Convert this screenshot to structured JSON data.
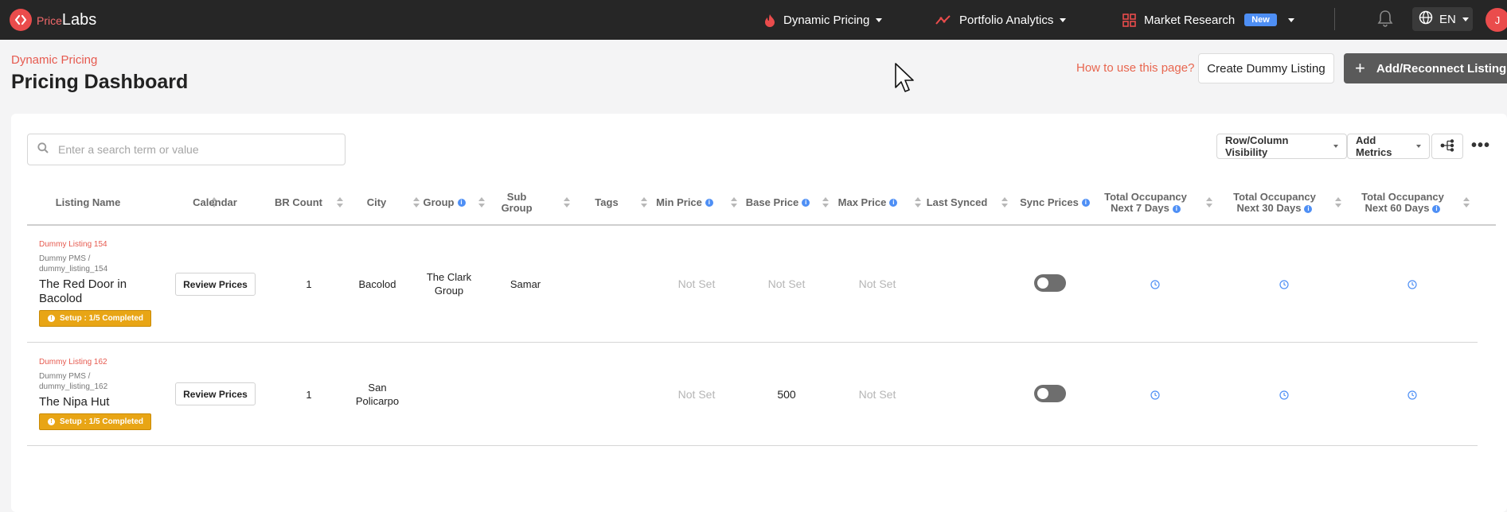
{
  "app": {
    "logo_part1": "Price",
    "logo_part2": "Labs"
  },
  "nav": {
    "dynamic_pricing": "Dynamic Pricing",
    "portfolio_analytics": "Portfolio Analytics",
    "market_research": "Market Research",
    "new_badge": "New",
    "language": "EN",
    "avatar": "J"
  },
  "page": {
    "breadcrumb": "Dynamic Pricing",
    "title": "Pricing Dashboard",
    "help_link": "How to use this page?",
    "create_dummy_button": "Create Dummy Listing",
    "add_listings_button": "Add/Reconnect Listings"
  },
  "toolbar": {
    "search_placeholder": "Enter a search term or value",
    "visibility_button": "Row/Column Visibility",
    "metrics_button": "Add Metrics",
    "more": "•••"
  },
  "table": {
    "headers": {
      "listing_name": "Listing Name",
      "calendar": "Calendar",
      "br_count": "BR Count",
      "city": "City",
      "group": "Group",
      "sub_group": "Sub Group",
      "tags": "Tags",
      "min_price": "Min Price",
      "base_price": "Base Price",
      "max_price": "Max Price",
      "last_synced": "Last Synced",
      "sync_prices": "Sync Prices",
      "occ7_line1": "Total Occupancy",
      "occ7_line2": "Next 7 Days",
      "occ30_line1": "Total Occupancy",
      "occ30_line2": "Next 30 Days",
      "occ60_line1": "Total Occupancy",
      "occ60_line2": "Next 60 Days"
    },
    "rows": [
      {
        "dummy_label": "Dummy Listing 154",
        "pms_line1": "Dummy PMS /",
        "pms_line2": "dummy_listing_154",
        "name_line1": "The Red Door in",
        "name_line2": "Bacolod",
        "setup": "Setup : 1/5 Completed",
        "calendar_button": "Review Prices",
        "br_count": "1",
        "city_line1": "Bacolod",
        "city_line2": "",
        "group_line1": "The Clark",
        "group_line2": "Group",
        "sub_group": "Samar",
        "min_price": "Not Set",
        "base_price": "Not Set",
        "max_price": "Not Set",
        "sync_on": false
      },
      {
        "dummy_label": "Dummy Listing 162",
        "pms_line1": "Dummy PMS /",
        "pms_line2": "dummy_listing_162",
        "name_line1": "The Nipa Hut",
        "name_line2": "",
        "setup": "Setup : 1/5 Completed",
        "calendar_button": "Review Prices",
        "br_count": "1",
        "city_line1": "San",
        "city_line2": "Policarpo",
        "group_line1": "",
        "group_line2": "",
        "sub_group": "",
        "min_price": "Not Set",
        "base_price": "500",
        "max_price": "Not Set",
        "sync_on": false
      }
    ]
  },
  "colors": {
    "accent_red": "#e65a4f",
    "info_blue": "#4e8ff5",
    "setup_orange": "#e8a515",
    "topbar_bg": "#262626"
  }
}
